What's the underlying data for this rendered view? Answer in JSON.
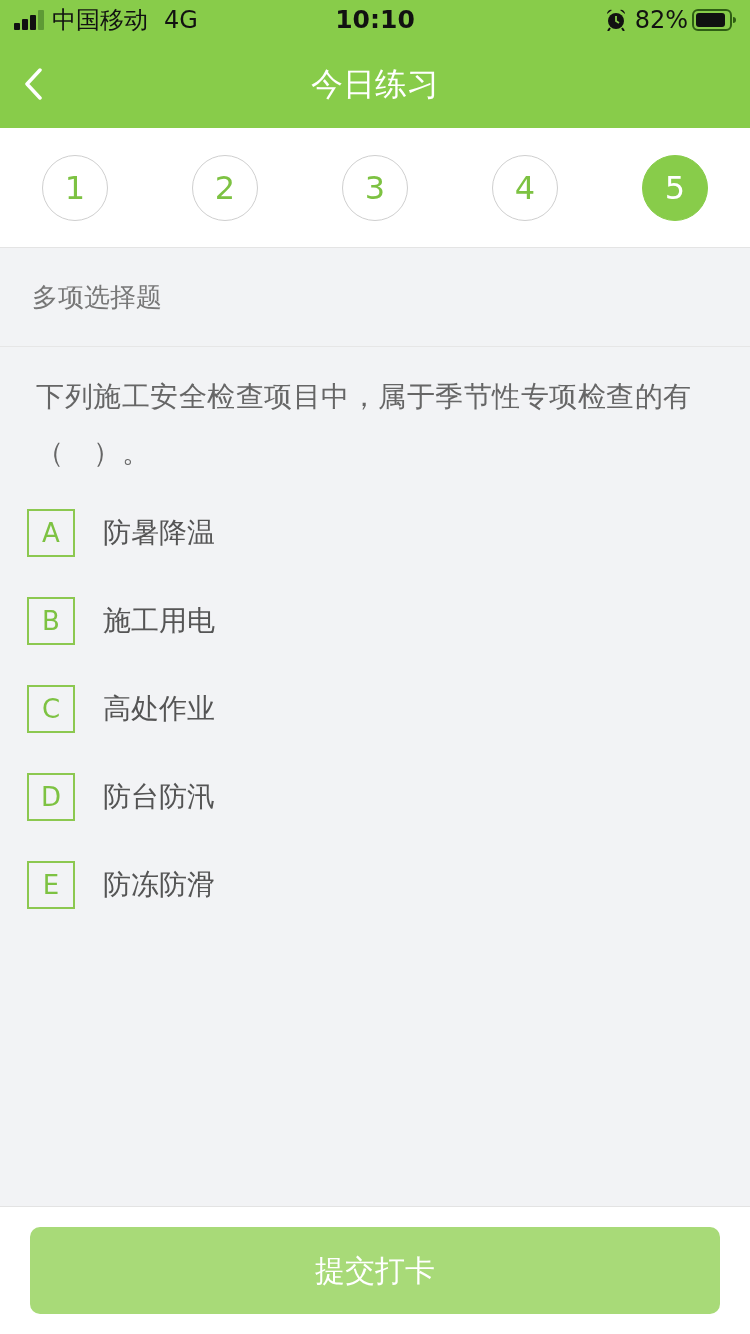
{
  "status_bar": {
    "carrier": "中国移动",
    "network": "4G",
    "time": "10:10",
    "battery": "82%"
  },
  "nav_bar": {
    "title": "今日练习"
  },
  "question_tabs": [
    {
      "label": "1",
      "selected": false
    },
    {
      "label": "2",
      "selected": false
    },
    {
      "label": "3",
      "selected": false
    },
    {
      "label": "4",
      "selected": false
    },
    {
      "label": "5",
      "selected": true
    }
  ],
  "section_label": "多项选择题",
  "question": {
    "text": "下列施工安全检查项目中，属于季节性专项检查的有（　）。"
  },
  "options": [
    {
      "letter": "A",
      "text": "防暑降温",
      "selected": false
    },
    {
      "letter": "B",
      "text": "施工用电",
      "selected": false
    },
    {
      "letter": "C",
      "text": "高处作业",
      "selected": false
    },
    {
      "letter": "D",
      "text": "防台防汛",
      "selected": false
    },
    {
      "letter": "E",
      "text": "防冻防滑",
      "selected": false
    }
  ],
  "submit_button": {
    "label": "提交打卡",
    "disabled": true
  }
}
